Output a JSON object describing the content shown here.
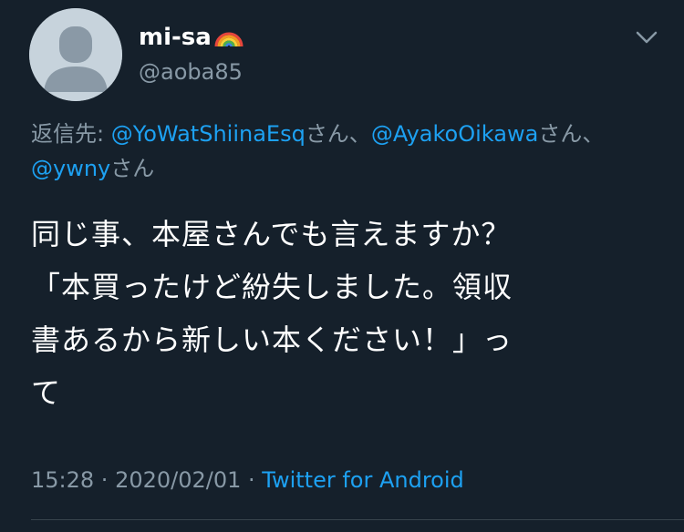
{
  "user": {
    "display_name": "mi-sa",
    "emoji": "rainbow",
    "handle": "@aoba85"
  },
  "menu_icon": "chevron-down-icon",
  "reply_context": {
    "prefix": "返信先:",
    "mention_1": "@YoWatShiinaEsq",
    "suffix_1": "さん、",
    "mention_2": "@AyakoOikawa",
    "suffix_2": "さん、",
    "mention_3": "@ywny",
    "suffix_3": "さん"
  },
  "tweet": {
    "lines": [
      "同じ事、本屋さんでも言えますか？",
      "「本買ったけど紛失しました。領収",
      "書あるから新しい本ください！」っ",
      "て"
    ]
  },
  "meta": {
    "time": "15:28",
    "separator": " · ",
    "date": "2020/02/01",
    "source": "Twitter for Android"
  },
  "colors": {
    "background": "#15202b",
    "link": "#1da1f2",
    "secondary_text": "#8899a6",
    "primary_text": "#ffffff",
    "avatar_bg": "#c7d3dc",
    "avatar_figure": "#8a99a6"
  }
}
